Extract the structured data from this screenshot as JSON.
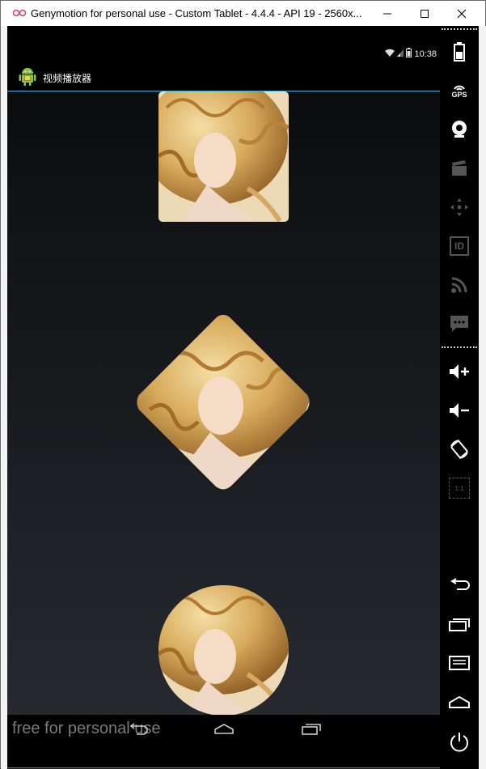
{
  "window": {
    "title": "Genymotion for personal use - Custom Tablet - 4.4.4 - API 19 - 2560x..."
  },
  "status_bar": {
    "time": "10:38"
  },
  "app": {
    "title": "视频播放器"
  },
  "watermark": "free for personal use",
  "colors": {
    "accent": "#33b5e5",
    "android_green": "#8cc43e"
  },
  "sidebar": {
    "icons": [
      "battery-icon",
      "gps-icon",
      "webcam-icon",
      "clapper-icon",
      "dpad-icon",
      "id-icon",
      "rss-icon",
      "sms-icon",
      "volume-up-icon",
      "volume-down-icon",
      "rotate-icon",
      "pixel-perfect-icon",
      "back-icon",
      "recent-apps-icon",
      "menu-icon",
      "home-icon",
      "power-icon"
    ],
    "gps_label": "GPS",
    "id_label": "ID",
    "pixel_label": "1:1"
  }
}
